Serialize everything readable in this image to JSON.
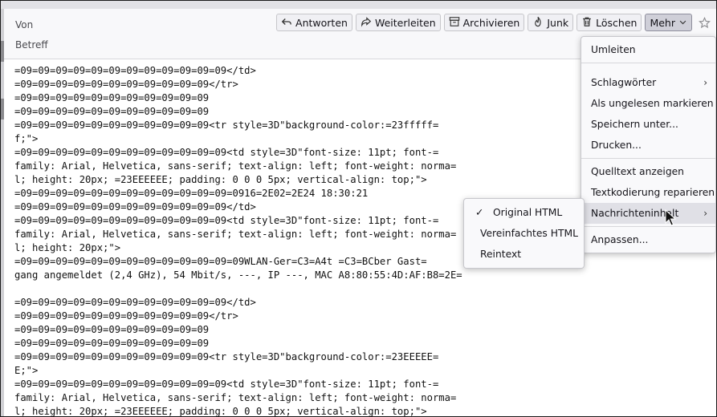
{
  "header": {
    "from_label": "Von",
    "subject_label": "Betreff"
  },
  "toolbar": {
    "reply": "Antworten",
    "forward": "Weiterleiten",
    "archive": "Archivieren",
    "junk": "Junk",
    "delete": "Löschen",
    "more": "Mehr"
  },
  "more_menu": {
    "redirect": "Umleiten",
    "tags": "Schlagwörter",
    "mark_unread": "Als ungelesen markieren",
    "save_as": "Speichern unter...",
    "print": "Drucken...",
    "view_source": "Quelltext anzeigen",
    "repair_encoding": "Textkodierung reparieren",
    "message_body": "Nachrichteninhalt",
    "customize": "Anpassen..."
  },
  "body_submenu": {
    "original_html": "Original HTML",
    "simple_html": "Vereinfachtes HTML",
    "plain_text": "Reintext"
  },
  "source_lines": [
    "=09=09=09=09=09=09=09=09=09=09=09=09</td>",
    "=09=09=09=09=09=09=09=09=09=09=09</tr>",
    "=09=09=09=09=09=09=09=09=09=09=09",
    "=09=09=09=09=09=09=09=09=09=09=09",
    "=09=09=09=09=09=09=09=09=09=09=09<tr style=3D\"background-color:=23fffff=",
    "f;\">",
    "=09=09=09=09=09=09=09=09=09=09=09=09<td style=3D\"font-size: 11pt; font-=",
    "family: Arial, Helvetica, sans-serif; text-align: left; font-weight: norma=",
    "l; height: 20px; =23EEEEEE; padding: 0 0 0 5px; vertical-align: top;\">",
    "=09=09=09=09=09=09=09=09=09=09=09=09=0916=2E02=2E24 18:30:21",
    "=09=09=09=09=09=09=09=09=09=09=09=09</td>",
    "=09=09=09=09=09=09=09=09=09=09=09=09<td style=3D\"font-size: 11pt; font-=",
    "family: Arial, Helvetica, sans-serif; text-align: left; font-weight: norma=",
    "l; height: 20px;\">",
    "=09=09=09=09=09=09=09=09=09=09=09=09=09WLAN-Ger=C3=A4t =C3=BCber Gast=",
    "gang angemeldet (2,4 GHz), 54 Mbit/s, ---, IP ---, MAC A8:80:55:4D:AF:B8=2E=",
    "",
    "=09=09=09=09=09=09=09=09=09=09=09=09</td>",
    "=09=09=09=09=09=09=09=09=09=09=09</tr>",
    "=09=09=09=09=09=09=09=09=09=09=09",
    "=09=09=09=09=09=09=09=09=09=09=09",
    "=09=09=09=09=09=09=09=09=09=09=09<tr style=3D\"background-color:=23EEEEE=",
    "E;\">",
    "=09=09=09=09=09=09=09=09=09=09=09=09<td style=3D\"font-size: 11pt; font-=",
    "family: Arial, Helvetica, sans-serif; text-align: left; font-weight: norma=",
    "l; height: 20px; =23EEEEEE; padding: 0 0 0 5px; vertical-align: top;\">"
  ]
}
